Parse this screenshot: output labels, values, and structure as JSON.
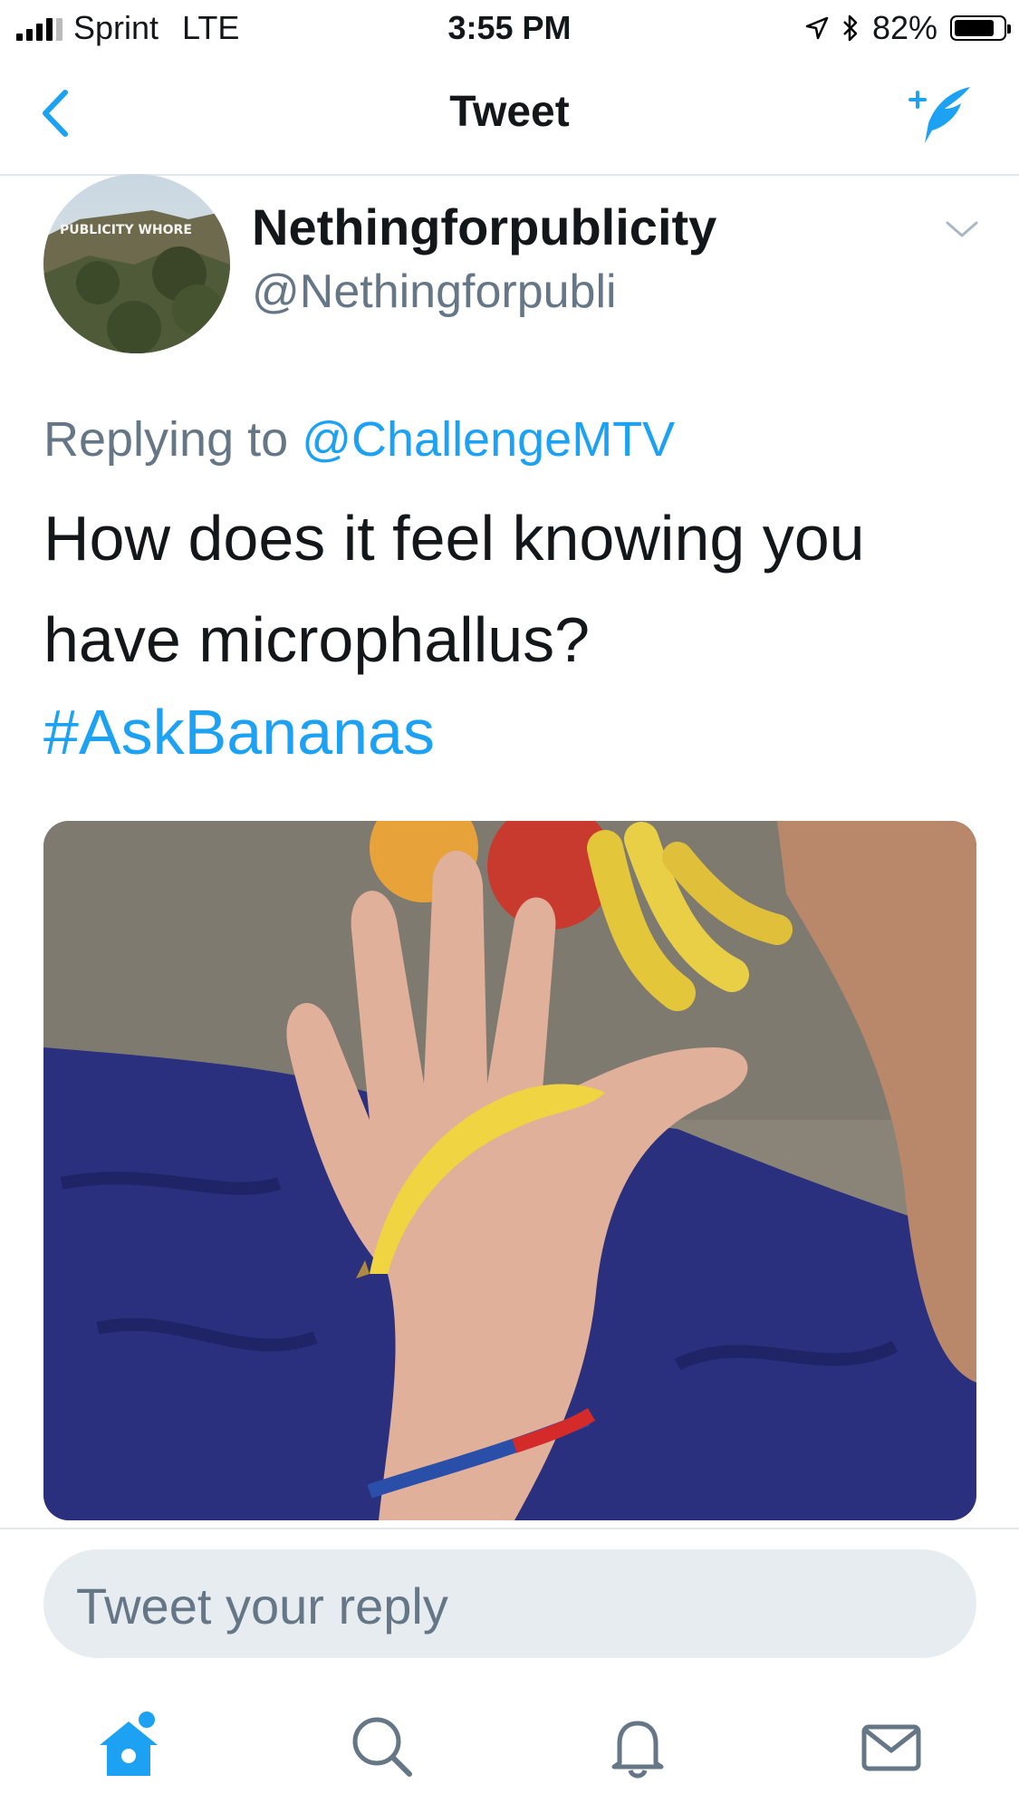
{
  "status_bar": {
    "carrier": "Sprint",
    "network": "LTE",
    "time": "3:55 PM",
    "battery": "82%",
    "battery_level": 0.82
  },
  "nav": {
    "title": "Tweet",
    "back_icon": "chevron-left-icon",
    "compose_icon": "compose-tweet-icon"
  },
  "tweet": {
    "display_name": "Nethingforpublicity",
    "handle": "@Nethingforpubli",
    "avatar_sign_text": "PUBLICITY WHORE",
    "replying_prefix": "Replying to",
    "replying_to": "@ChallengeMTV",
    "text": "How does it feel knowing you have microphallus?",
    "hashtag": "#AskBananas"
  },
  "reply": {
    "placeholder": "Tweet your reply"
  },
  "tabbar": {
    "items": [
      "home-icon",
      "search-icon",
      "notifications-icon",
      "messages-icon"
    ]
  },
  "colors": {
    "accent": "#1da1f2",
    "secondary_text": "#657786",
    "reply_bg": "#e6ecf0"
  }
}
